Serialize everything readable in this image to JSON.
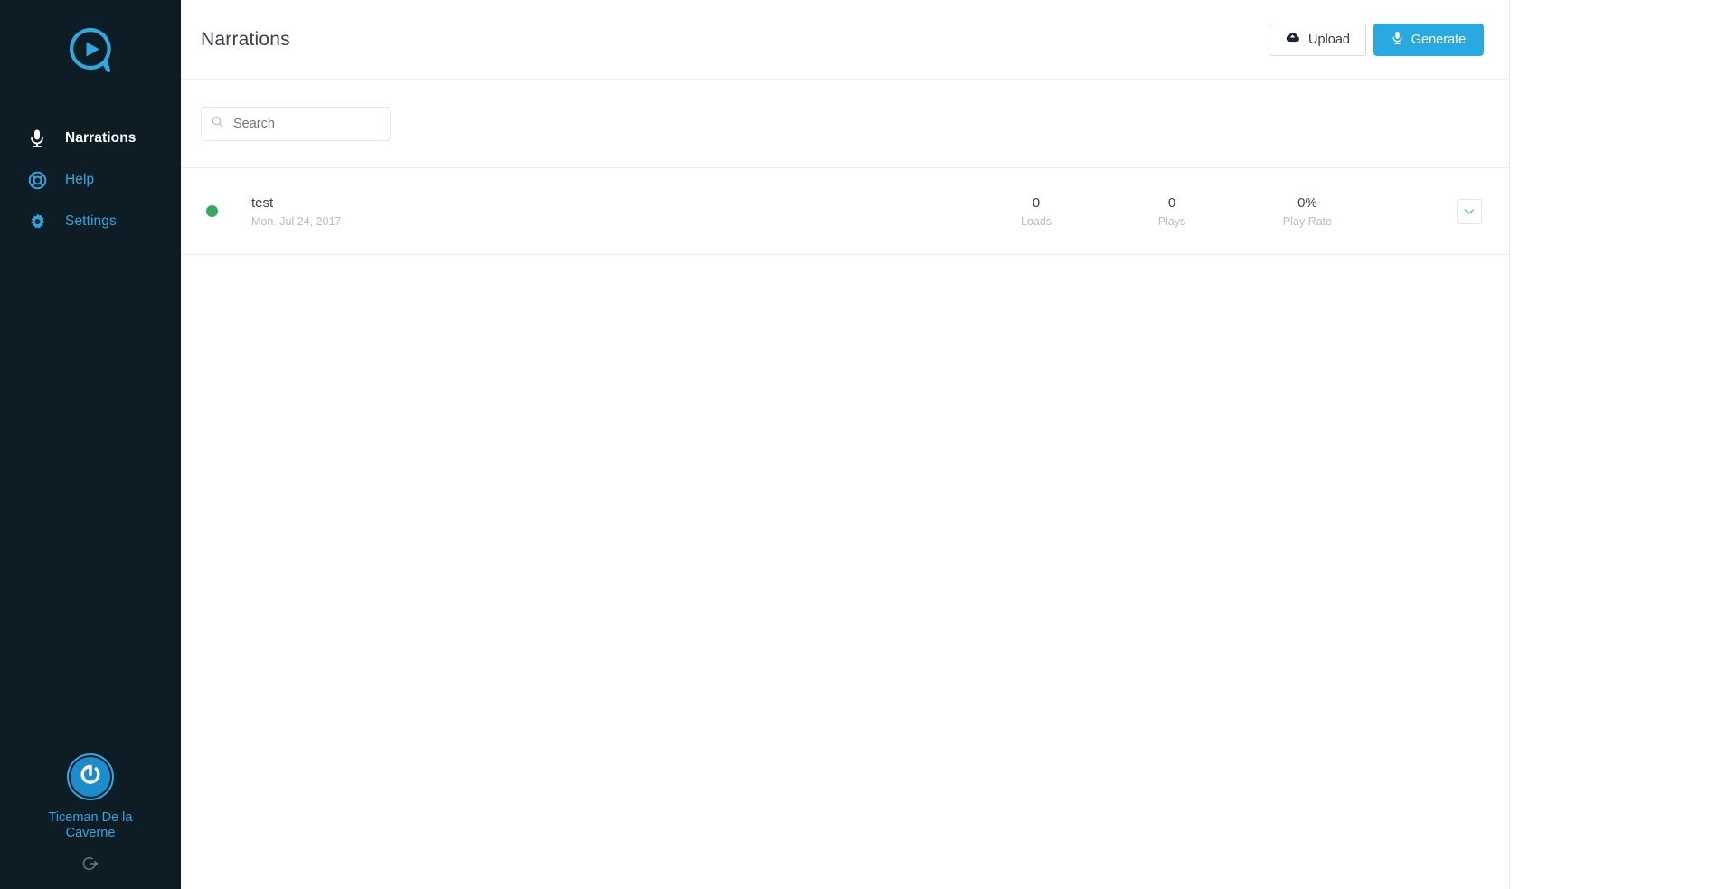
{
  "colors": {
    "sidebar_bg": "#0e1c26",
    "accent_blue": "#29a9e1",
    "status_green": "#33a95e",
    "title_text": "#3a444e",
    "muted_text": "#b6bcc2"
  },
  "sidebar": {
    "logo_name": "play-bubble-logo",
    "items": [
      {
        "label": "Narrations",
        "icon": "microphone-icon",
        "active": true
      },
      {
        "label": "Help",
        "icon": "life-ring-icon",
        "active": false
      },
      {
        "label": "Settings",
        "icon": "gear-icon",
        "active": false
      }
    ],
    "user": {
      "name": "Ticeman De la Caverne",
      "avatar_icon": "power-avatar-icon",
      "logout_icon": "sign-out-icon"
    }
  },
  "header": {
    "title": "Narrations",
    "upload_label": "Upload",
    "upload_icon": "cloud-upload-icon",
    "generate_label": "Generate",
    "generate_icon": "microphone-icon"
  },
  "search": {
    "icon": "search-icon",
    "placeholder": "Search",
    "value": ""
  },
  "list": {
    "rows": [
      {
        "status": "active",
        "title": "test",
        "date": "Mon. Jul 24, 2017",
        "stats": [
          {
            "value": "0",
            "label": "Loads"
          },
          {
            "value": "0",
            "label": "Plays"
          },
          {
            "value": "0%",
            "label": "Play Rate"
          }
        ],
        "action_icon": "chevron-down-icon"
      }
    ]
  }
}
